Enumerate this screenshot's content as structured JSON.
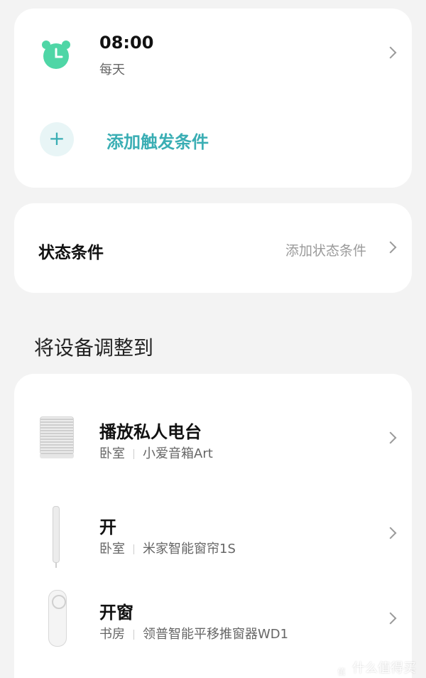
{
  "trigger": {
    "time": "08:00",
    "repeat": "每天",
    "add_label": "添加触发条件",
    "add_symbol": "+",
    "icon": "alarm-clock-icon",
    "accent": "#3aaeb4",
    "clock_color": "#4fd6a6"
  },
  "state": {
    "label": "状态条件",
    "hint": "添加状态条件"
  },
  "section": {
    "heading": "将设备调整到"
  },
  "actions": [
    {
      "title": "播放私人电台",
      "room": "卧室",
      "device": "小爱音箱Art",
      "icon": "smart-speaker-icon"
    },
    {
      "title": "开",
      "room": "卧室",
      "device": "米家智能窗帘1S",
      "icon": "curtain-motor-icon"
    },
    {
      "title": "开窗",
      "room": "书房",
      "device": "领普智能平移推窗器WD1",
      "icon": "window-opener-icon"
    }
  ],
  "watermark": {
    "text": "什么值得买",
    "glyph": "值"
  }
}
